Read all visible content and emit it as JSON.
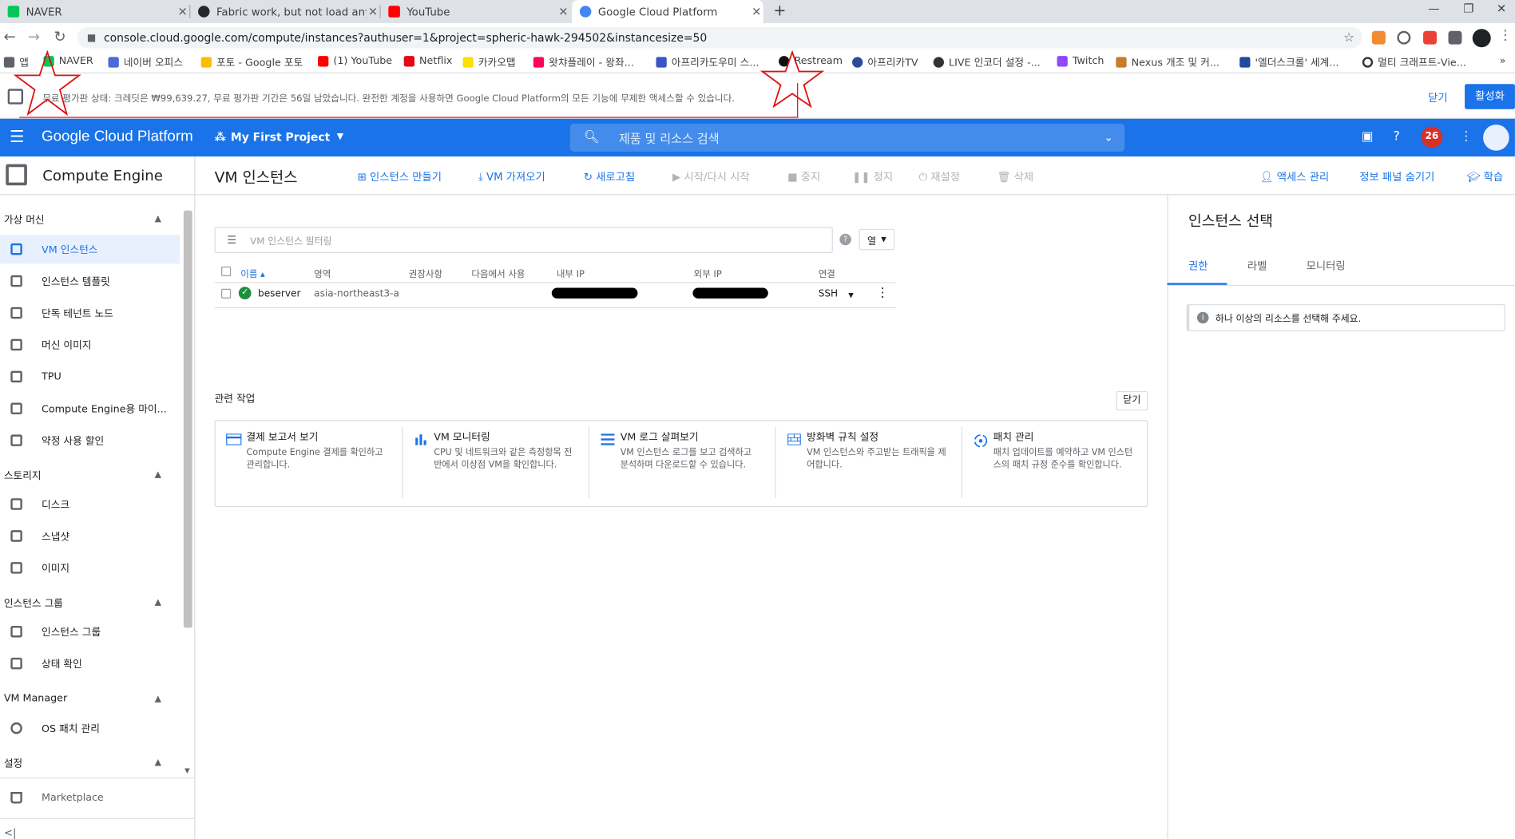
{
  "browser": {
    "tabs": [
      {
        "title": "NAVER",
        "color": "#03c75a"
      },
      {
        "title": "Fabric work, but not load any m",
        "color": "#24292e"
      },
      {
        "title": "YouTube",
        "color": "#ff0000"
      },
      {
        "title": "Google Cloud Platform",
        "color": "#4285f4"
      }
    ],
    "new_tab": "+",
    "url": "console.cloud.google.com/compute/instances?authuser=1&project=spheric-hawk-294502&instancesize=50",
    "bookmarks": [
      "앱",
      "NAVER",
      "네이버 오피스",
      "포토 - Google 포토",
      "(1) YouTube",
      "Netflix",
      "카카오맵",
      "왓챠플레이 - 왕좌...",
      "아프리카도우미 스...",
      "Restream",
      "아프리카TV",
      "LIVE 인코더 설정 -...",
      "Twitch",
      "Nexus 개조 및 커...",
      "'엘더스크롤' 세계...",
      "멀티 크래프트-Vie..."
    ]
  },
  "banner": {
    "message": "무료 평가판 상태: 크레딧은 ₩99,639.27, 무료 평가판 기간은 56일 남았습니다. 완전한 계정을 사용하면 Google Cloud Platform의 모든 기능에 무제한 액세스할 수 있습니다.",
    "close": "닫기",
    "activate": "활성화"
  },
  "header": {
    "brand": "Google Cloud Platform",
    "project": "My First Project",
    "search_placeholder": "제품 및 리소스 검색",
    "notifications": "26"
  },
  "product": {
    "name": "Compute Engine"
  },
  "page": {
    "title": "VM 인스턴스",
    "actions": [
      "인스턴스 만들기",
      "VM 가져오기",
      "새로고침",
      "시작/다시 시작",
      "중지",
      "정지",
      "재설정",
      "삭제"
    ],
    "right_actions": [
      "액세스 관리",
      "정보 패널 숨기기",
      "학습"
    ]
  },
  "sidebar": {
    "sections": [
      {
        "label": "가상 머신",
        "items": [
          "VM 인스턴스",
          "인스턴스 템플릿",
          "단독 테넌트 노드",
          "머신 이미지",
          "TPU",
          "Compute Engine용 마이...",
          "약정 사용 할인"
        ]
      },
      {
        "label": "스토리지",
        "items": [
          "디스크",
          "스냅샷",
          "이미지"
        ]
      },
      {
        "label": "인스턴스 그룹",
        "items": [
          "인스턴스 그룹",
          "상태 확인"
        ]
      },
      {
        "label": "VM Manager",
        "items": [
          "OS 패치 관리"
        ]
      },
      {
        "label": "설정",
        "items": []
      }
    ],
    "marketplace": "Marketplace",
    "collapse": "<|"
  },
  "table": {
    "filter_placeholder": "VM 인스턴스 필터링",
    "columns_button": "열",
    "headers": [
      "이름",
      "영역",
      "권장사항",
      "다음에서 사용",
      "내부 IP",
      "외부 IP",
      "연결"
    ],
    "rows": [
      {
        "name": "beserver",
        "zone": "asia-northeast3-a",
        "connect": "SSH"
      }
    ]
  },
  "related": {
    "title": "관련 작업",
    "close": "닫기",
    "cards": [
      {
        "title": "결제 보고서 보기",
        "desc": "Compute Engine 결제를 확인하고 관리합니다."
      },
      {
        "title": "VM 모니터링",
        "desc": "CPU 및 네트워크와 같은 측정항목 전반에서 이상점 VM을 확인합니다."
      },
      {
        "title": "VM 로그 살펴보기",
        "desc": "VM 인스턴스 로그를 보고 검색하고 분석하며 다운로드할 수 있습니다."
      },
      {
        "title": "방화벽 규칙 설정",
        "desc": "VM 인스턴스와 주고받는 트래픽을 제어합니다."
      },
      {
        "title": "패치 관리",
        "desc": "패치 업데이트를 예약하고 VM 인스턴스의 패치 규정 준수를 확인합니다."
      }
    ]
  },
  "panel": {
    "title": "인스턴스 선택",
    "tabs": [
      "권한",
      "라벨",
      "모니터링"
    ],
    "info": "하나 이상의 리소스를 선택해 주세요."
  }
}
